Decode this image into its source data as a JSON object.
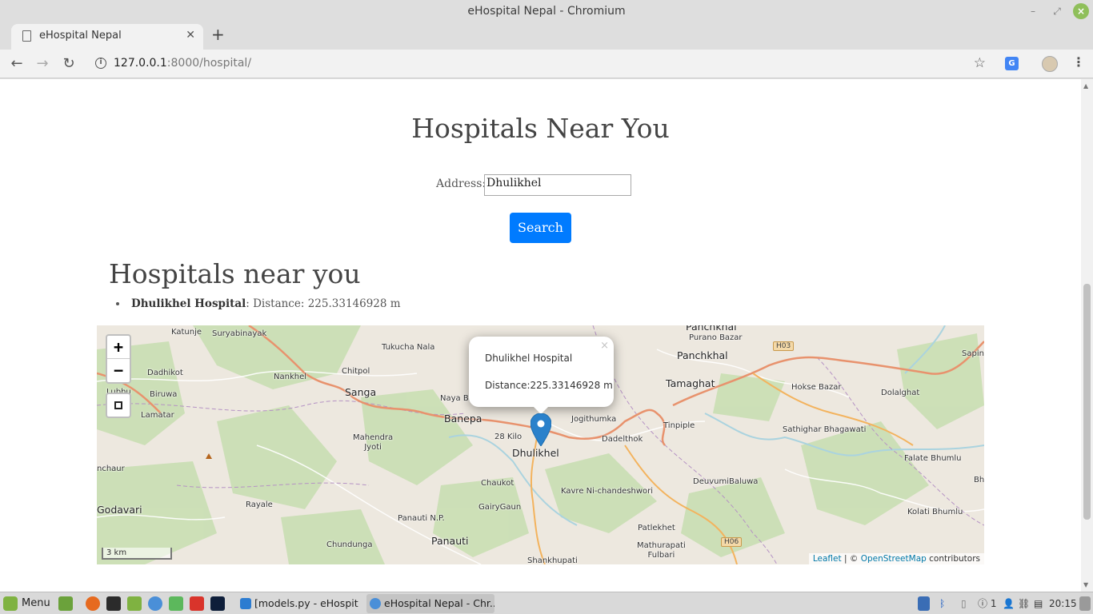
{
  "window": {
    "title": "eHospital Nepal - Chromium"
  },
  "browser": {
    "tab_title": "eHospital Nepal",
    "url_host": "127.0.0.1",
    "url_rest": ":8000/hospital/"
  },
  "page": {
    "heading": "Hospitals Near You",
    "address_label": "Address:",
    "address_value": "Dhulikhel",
    "search_label": "Search",
    "results_heading": "Hospitals near you",
    "results": [
      {
        "name": "Dhulikhel Hospital",
        "distance_text": ": Distance: 225.33146928 m"
      }
    ]
  },
  "map": {
    "popup": {
      "name": "Dhulikhel Hospital",
      "distance": "Distance:225.33146928 m"
    },
    "zoom_in": "+",
    "zoom_out": "−",
    "scale_label": "3 km",
    "attribution": {
      "leaflet": "Leaflet",
      "sep": " | © ",
      "osm": "OpenStreetMap",
      "tail": " contributors"
    },
    "labels": {
      "katunje": "Katunje",
      "suryabinayak": "Suryabinayak",
      "tukucha": "Tukucha Nala",
      "panchkhal_top": "Panchkhal",
      "purano": "Purano Bazar",
      "panchkhal": "Panchkhal",
      "dadhikot": "Dadhikot",
      "nankhel": "Nankhel",
      "chitpol": "Chitpol",
      "tamaghat": "Tamaghat",
      "hokse": "Hokse Bazar",
      "dolalghat": "Dolalghat",
      "saping": "Saping",
      "biruwa": "Biruwa",
      "sanga": "Sanga",
      "naya": "Naya B",
      "lubhu": "Lubhu",
      "lamatar": "Lamatar",
      "banepa": "Banepa",
      "jogithumka": "Jogithumka",
      "mahendra": "Mahendra\nJyoti",
      "kilo28": "28 Kilo",
      "dadelthok": "Dadelthok",
      "tinpiple": "Tinpiple",
      "sathighar": "Sathighar Bhagawati",
      "dhulikhel": "Dhulikhel",
      "nchaur": "nchaur",
      "falate": "Falate Bhumlu",
      "chaukot": "Chaukot",
      "deuvumi": "DeuvumiBaluwa",
      "kavre": "Kavre Ni-chandeshwori",
      "godavari": "Godavari",
      "rayale": "Rayale",
      "gairygaun": "GairyGaun",
      "kolati": "Kolati Bhumlu",
      "panauti_np": "Panauti N.P.",
      "patlekhet": "Patlekhet",
      "chundunga": "Chundunga",
      "panauti": "Panauti",
      "mathurapati": "Mathurapati\nFulbari",
      "shankhupati": "Shankhupati",
      "bh": "Bh"
    },
    "roads": {
      "h03": "H03",
      "h06": "H06"
    }
  },
  "taskbar": {
    "menu_label": "Menu",
    "windows": [
      {
        "label": "[models.py - eHospit..."
      },
      {
        "label": "eHospital Nepal - Chr..."
      }
    ],
    "tray_count": "1",
    "clock": "20:15"
  }
}
